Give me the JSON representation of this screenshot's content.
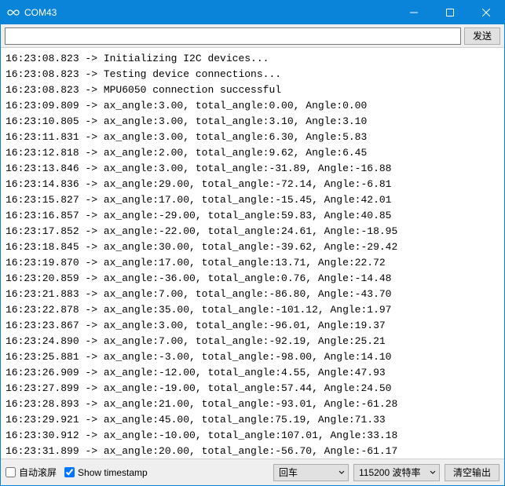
{
  "window": {
    "title": "COM43"
  },
  "toolbar": {
    "input_value": "",
    "input_placeholder": "",
    "send_label": "发送"
  },
  "output_lines": [
    "16:23:08.823 -> Initializing I2C devices...",
    "16:23:08.823 -> Testing device connections...",
    "16:23:08.823 -> MPU6050 connection successful",
    "16:23:09.809 -> ax_angle:3.00, total_angle:0.00, Angle:0.00",
    "16:23:10.805 -> ax_angle:3.00, total_angle:3.10, Angle:3.10",
    "16:23:11.831 -> ax_angle:3.00, total_angle:6.30, Angle:5.83",
    "16:23:12.818 -> ax_angle:2.00, total_angle:9.62, Angle:6.45",
    "16:23:13.846 -> ax_angle:3.00, total_angle:-31.89, Angle:-16.88",
    "16:23:14.836 -> ax_angle:29.00, total_angle:-72.14, Angle:-6.81",
    "16:23:15.827 -> ax_angle:17.00, total_angle:-15.45, Angle:42.01",
    "16:23:16.857 -> ax_angle:-29.00, total_angle:59.83, Angle:40.85",
    "16:23:17.852 -> ax_angle:-22.00, total_angle:24.61, Angle:-18.95",
    "16:23:18.845 -> ax_angle:30.00, total_angle:-39.62, Angle:-29.42",
    "16:23:19.870 -> ax_angle:17.00, total_angle:13.71, Angle:22.72",
    "16:23:20.859 -> ax_angle:-36.00, total_angle:0.76, Angle:-14.48",
    "16:23:21.883 -> ax_angle:7.00, total_angle:-86.80, Angle:-43.70",
    "16:23:22.878 -> ax_angle:35.00, total_angle:-101.12, Angle:1.97",
    "16:23:23.867 -> ax_angle:3.00, total_angle:-96.01, Angle:19.37",
    "16:23:24.890 -> ax_angle:7.00, total_angle:-92.19, Angle:25.21",
    "16:23:25.881 -> ax_angle:-3.00, total_angle:-98.00, Angle:14.10",
    "16:23:26.909 -> ax_angle:-12.00, total_angle:4.55, Angle:47.93",
    "16:23:27.899 -> ax_angle:-19.00, total_angle:57.44, Angle:24.50",
    "16:23:28.893 -> ax_angle:21.00, total_angle:-93.01, Angle:-61.28",
    "16:23:29.921 -> ax_angle:45.00, total_angle:75.19, Angle:71.33",
    "16:23:30.912 -> ax_angle:-10.00, total_angle:107.01, Angle:33.18",
    "16:23:31.899 -> ax_angle:20.00, total_angle:-56.70, Angle:-61.17"
  ],
  "statusbar": {
    "autoscroll_label": "自动滚屏",
    "autoscroll_checked": false,
    "timestamp_label": "Show timestamp",
    "timestamp_checked": true,
    "line_ending_selected": "回车",
    "baud_selected": "115200 波特率",
    "clear_label": "清空输出"
  }
}
